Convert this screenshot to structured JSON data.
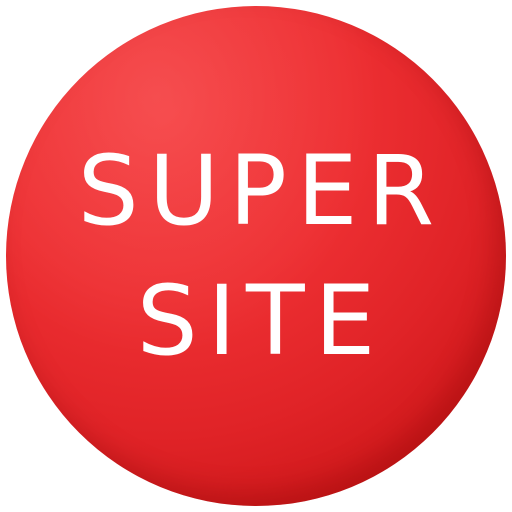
{
  "logo": {
    "line1": "SUPER",
    "line2": "SITE",
    "colors": {
      "circle": "#e4272b",
      "circle_dark": "#bb0d0f",
      "text": "#ffffff",
      "background": "#ffffff"
    }
  }
}
